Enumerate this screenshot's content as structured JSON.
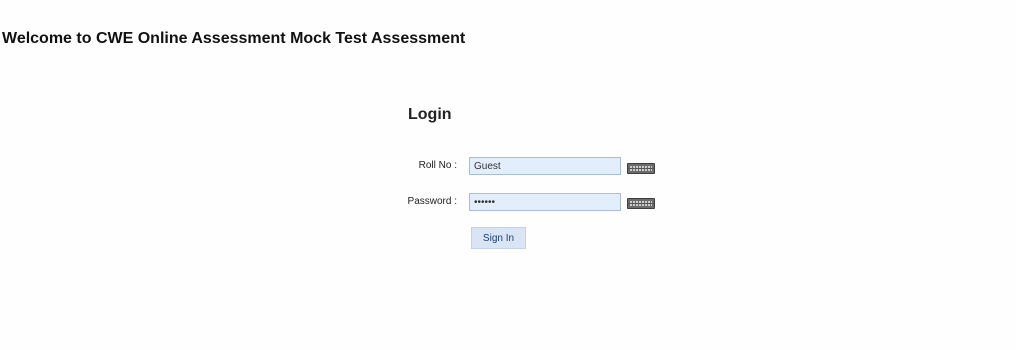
{
  "header": {
    "welcome_text": "Welcome to CWE Online Assessment Mock Test Assessment"
  },
  "login": {
    "title": "Login",
    "roll_no_label": "Roll No :",
    "roll_no_value": "Guest",
    "password_label": "Password :",
    "password_value": "••••••",
    "sign_in_label": "Sign In"
  },
  "icons": {
    "roll_no_keyboard": "virtual-keyboard-icon",
    "password_keyboard": "virtual-keyboard-icon"
  }
}
